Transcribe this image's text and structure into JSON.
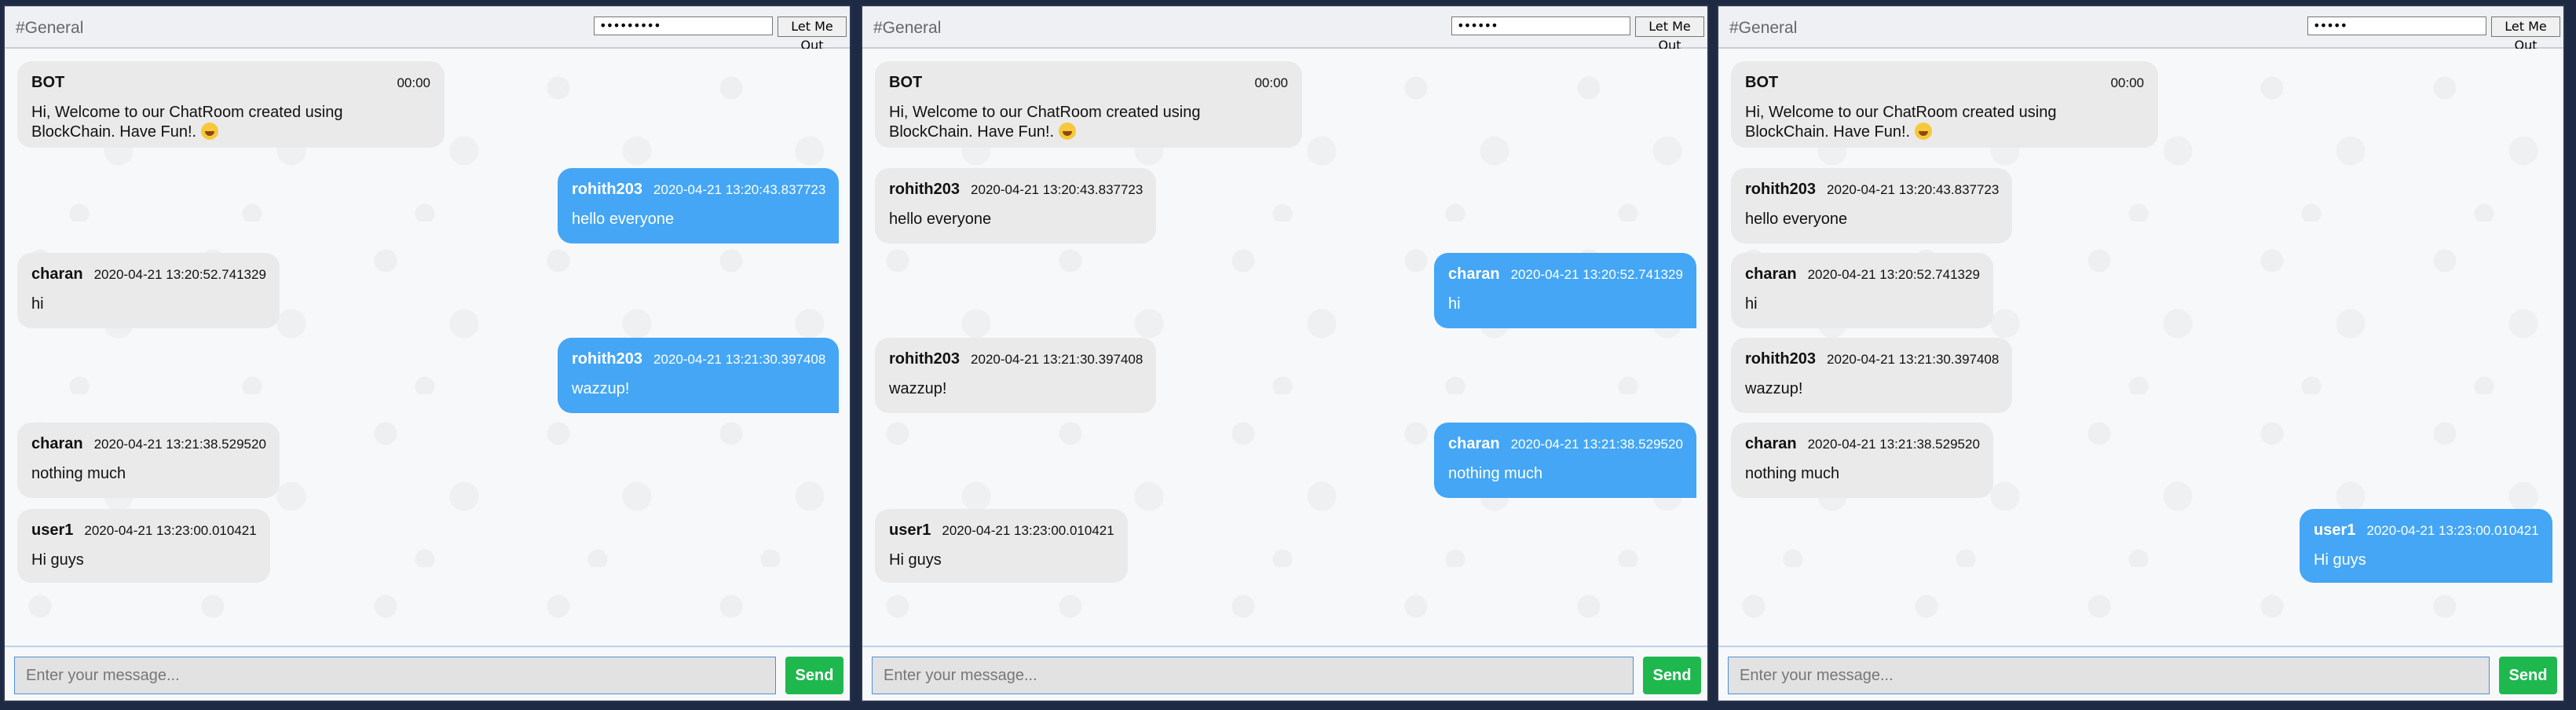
{
  "panels": [
    {
      "channel": "#General",
      "password_masked": "•••••••••",
      "logout_label": "Let Me Out",
      "input_placeholder": "Enter your message...",
      "send_label": "Send",
      "messages": [
        {
          "sender": "BOT",
          "time": "00:00",
          "text": "Hi, Welcome to our ChatRoom created using BlockChain. Have Fun!.",
          "emoji": "grinning-face-icon",
          "side": "left"
        },
        {
          "sender": "rohith203",
          "time": "2020-04-21 13:20:43.837723",
          "text": "hello everyone",
          "side": "right"
        },
        {
          "sender": "charan",
          "time": "2020-04-21 13:20:52.741329",
          "text": "hi",
          "side": "left"
        },
        {
          "sender": "rohith203",
          "time": "2020-04-21 13:21:30.397408",
          "text": "wazzup!",
          "side": "right"
        },
        {
          "sender": "charan",
          "time": "2020-04-21 13:21:38.529520",
          "text": "nothing much",
          "side": "left"
        },
        {
          "sender": "user1",
          "time": "2020-04-21 13:23:00.010421",
          "text": "Hi guys",
          "side": "left"
        }
      ]
    },
    {
      "channel": "#General",
      "password_masked": "••••••",
      "logout_label": "Let Me Out",
      "input_placeholder": "Enter your message...",
      "send_label": "Send",
      "messages": [
        {
          "sender": "BOT",
          "time": "00:00",
          "text": "Hi, Welcome to our ChatRoom created using BlockChain. Have Fun!.",
          "emoji": "grinning-face-icon",
          "side": "left"
        },
        {
          "sender": "rohith203",
          "time": "2020-04-21 13:20:43.837723",
          "text": "hello everyone",
          "side": "left"
        },
        {
          "sender": "charan",
          "time": "2020-04-21 13:20:52.741329",
          "text": "hi",
          "side": "right"
        },
        {
          "sender": "rohith203",
          "time": "2020-04-21 13:21:30.397408",
          "text": "wazzup!",
          "side": "left"
        },
        {
          "sender": "charan",
          "time": "2020-04-21 13:21:38.529520",
          "text": "nothing much",
          "side": "right"
        },
        {
          "sender": "user1",
          "time": "2020-04-21 13:23:00.010421",
          "text": "Hi guys",
          "side": "left"
        }
      ]
    },
    {
      "channel": "#General",
      "password_masked": "•••••",
      "logout_label": "Let Me Out",
      "input_placeholder": "Enter your message...",
      "send_label": "Send",
      "messages": [
        {
          "sender": "BOT",
          "time": "00:00",
          "text": "Hi, Welcome to our ChatRoom created using BlockChain. Have Fun!.",
          "emoji": "grinning-face-icon",
          "side": "left"
        },
        {
          "sender": "rohith203",
          "time": "2020-04-21 13:20:43.837723",
          "text": "hello everyone",
          "side": "left"
        },
        {
          "sender": "charan",
          "time": "2020-04-21 13:20:52.741329",
          "text": "hi",
          "side": "left"
        },
        {
          "sender": "rohith203",
          "time": "2020-04-21 13:21:30.397408",
          "text": "wazzup!",
          "side": "left"
        },
        {
          "sender": "charan",
          "time": "2020-04-21 13:21:38.529520",
          "text": "nothing much",
          "side": "left"
        },
        {
          "sender": "user1",
          "time": "2020-04-21 13:23:00.010421",
          "text": "Hi guys",
          "side": "right"
        }
      ]
    }
  ],
  "colors": {
    "own_bubble": "#44a6f4",
    "other_bubble": "#eaeaea",
    "send_button": "#1fb84f"
  }
}
